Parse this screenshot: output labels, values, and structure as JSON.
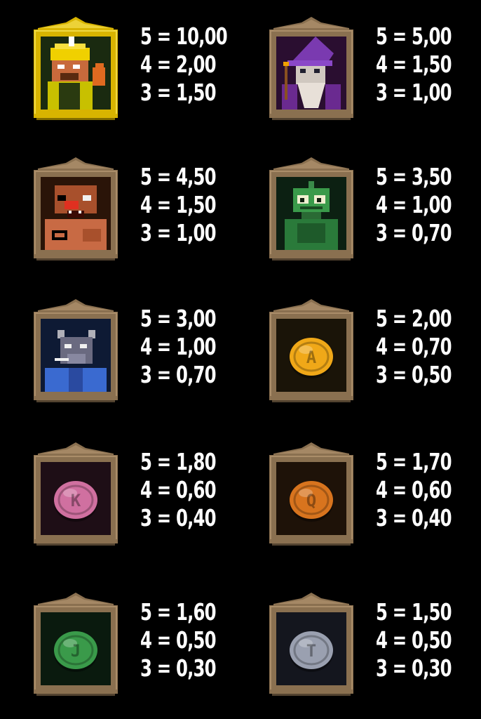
{
  "symbols": [
    {
      "id": "miner",
      "icon": "miner-portrait-icon",
      "frame_color": "#d8b400",
      "bg": "#1a2a10",
      "pays": [
        "5 = 10,00",
        "4 = 2,00",
        "3 = 1,50"
      ]
    },
    {
      "id": "wizard",
      "icon": "wizard-portrait-icon",
      "frame_color": "#8a7050",
      "bg": "#2a0e30",
      "pays": [
        "5 = 5,00",
        "4 = 1,50",
        "3 = 1,00"
      ]
    },
    {
      "id": "ogre",
      "icon": "ogre-portrait-icon",
      "frame_color": "#8a7050",
      "bg": "#2a1408",
      "pays": [
        "5 = 4,50",
        "4 = 1,50",
        "3 = 1,00"
      ]
    },
    {
      "id": "robot",
      "icon": "robot-portrait-icon",
      "frame_color": "#8a7050",
      "bg": "#0c2012",
      "pays": [
        "5 = 3,50",
        "4 = 1,00",
        "3 = 0,70"
      ]
    },
    {
      "id": "goat",
      "icon": "goat-portrait-icon",
      "frame_color": "#8a7050",
      "bg": "#0e1a34",
      "pays": [
        "5 = 3,00",
        "4 = 1,00",
        "3 = 0,70"
      ]
    },
    {
      "id": "coin-a",
      "icon": "coin-a-icon",
      "letter": "A",
      "frame_color": "#8a7050",
      "bg": "#1a1408",
      "coin": "#f0a818",
      "pays": [
        "5 = 2,00",
        "4 = 0,70",
        "3 = 0,50"
      ]
    },
    {
      "id": "coin-k",
      "icon": "coin-k-icon",
      "letter": "K",
      "frame_color": "#8a7050",
      "bg": "#1e0e16",
      "coin": "#d070a0",
      "pays": [
        "5 = 1,80",
        "4 = 0,60",
        "3 = 0,40"
      ]
    },
    {
      "id": "coin-q",
      "icon": "coin-q-icon",
      "letter": "Q",
      "frame_color": "#8a7050",
      "bg": "#1e1208",
      "coin": "#d8741e",
      "pays": [
        "5 = 1,70",
        "4 = 0,60",
        "3 = 0,40"
      ]
    },
    {
      "id": "coin-j",
      "icon": "coin-j-icon",
      "letter": "J",
      "frame_color": "#8a7050",
      "bg": "#0a1a0e",
      "coin": "#3a9a4a",
      "pays": [
        "5 = 1,60",
        "4 = 0,50",
        "3 = 0,30"
      ]
    },
    {
      "id": "coin-t",
      "icon": "coin-t-icon",
      "letter": "T",
      "frame_color": "#8a7050",
      "bg": "#14161e",
      "coin": "#9aa0b0",
      "pays": [
        "5 = 1,50",
        "4 = 0,50",
        "3 = 0,30"
      ]
    }
  ]
}
